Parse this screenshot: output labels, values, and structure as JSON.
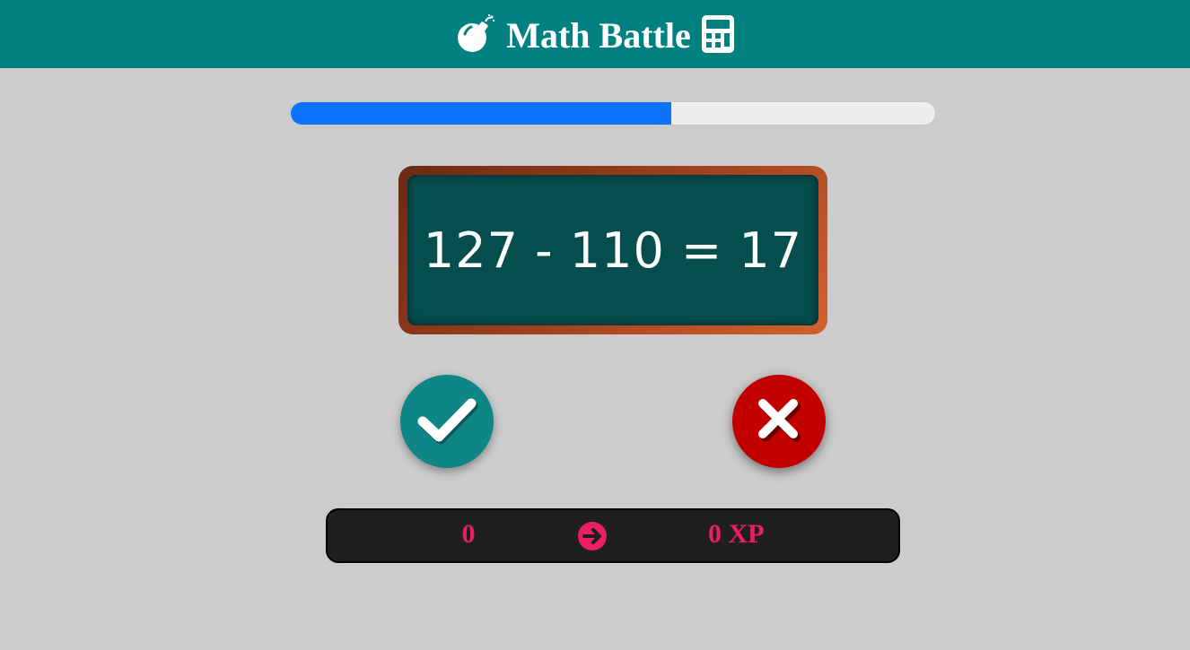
{
  "header": {
    "title": "Math Battle",
    "left_icon": "bomb-icon",
    "right_icon": "calculator-icon"
  },
  "progress": {
    "fraction": 0.59,
    "color": "#0a74ff"
  },
  "question": {
    "equation": "127 - 110 = 17"
  },
  "actions": {
    "correct_icon": "checkmark-icon",
    "wrong_icon": "close-icon"
  },
  "score": {
    "value": "0",
    "arrow_icon": "arrow-right-circle-icon",
    "xp": "0 XP"
  },
  "colors": {
    "header": "#008080",
    "background": "#cccccc",
    "board_slate": "#064d4d",
    "correct": "#0f8686",
    "wrong": "#c20000",
    "score_accent": "#e91e63"
  }
}
